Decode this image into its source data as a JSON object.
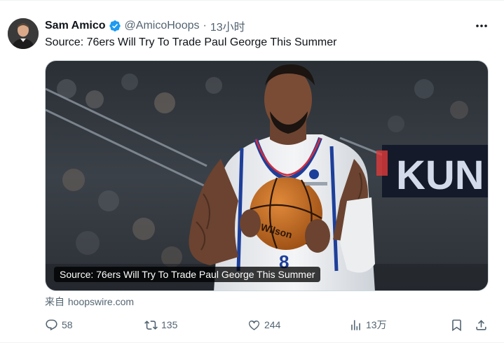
{
  "author": {
    "display_name": "Sam Amico",
    "handle": "@AmicoHoops",
    "separator": "·",
    "time": "13小时",
    "verified": true
  },
  "tweet": {
    "text": "Source: 76ers Will Try To Trade Paul George This Summer"
  },
  "media": {
    "caption": "Source: 76ers Will Try To Trade Paul George This Summer",
    "jersey_number": "8",
    "arena_sign": "KUN"
  },
  "link_source": {
    "label": "来自",
    "domain": "hoopswire.com"
  },
  "actions": {
    "replies": "58",
    "reposts": "135",
    "likes": "244",
    "views": "13万"
  },
  "icons": {
    "verified": "verified-badge-icon",
    "more": "more-options-icon",
    "reply": "reply-icon",
    "repost": "repost-icon",
    "like": "heart-icon",
    "views": "views-chart-icon",
    "bookmark": "bookmark-icon",
    "share": "share-icon"
  },
  "colors": {
    "accent": "#1d9bf0",
    "secondary_text": "#536471",
    "primary_text": "#0f1419"
  }
}
